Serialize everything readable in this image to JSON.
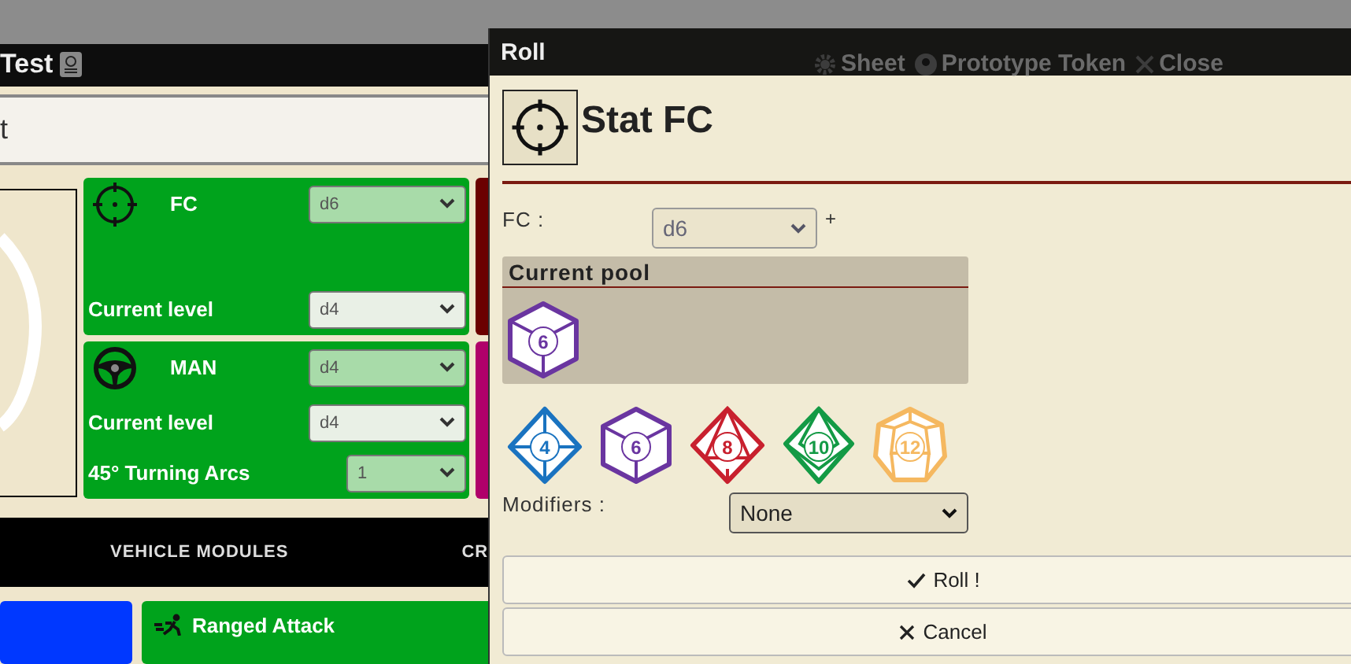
{
  "sheet": {
    "title": "Test",
    "actions": [
      {
        "label": "Sheet",
        "kind": "gear"
      },
      {
        "label": "Prototype Token",
        "kind": "user"
      },
      {
        "label": "Close",
        "kind": "close"
      }
    ],
    "name_field": {
      "value": "t"
    },
    "stats": [
      {
        "name": "FC",
        "kind": "crosshair",
        "rows": [
          {
            "value": "d6",
            "disabled": true
          },
          {
            "label": "Current level",
            "value": "d4",
            "disabled": false
          }
        ]
      },
      {
        "name": "MAN",
        "kind": "wheel",
        "rows": [
          {
            "value": "d4",
            "disabled": true
          },
          {
            "label": "Current level",
            "value": "d4",
            "disabled": false
          },
          {
            "label": "45° Turning Arcs",
            "value": "1",
            "disabled": true,
            "narrow": true
          }
        ]
      }
    ],
    "side_cards": [
      {
        "color": "#6b0000"
      },
      {
        "color": "#b0006a"
      }
    ],
    "nav": [
      {
        "label": "VEHICLE MODULES"
      },
      {
        "label": "CR"
      }
    ],
    "bottom_cards": [
      {
        "color": "#0038ff"
      },
      {
        "color": "#00a31c",
        "label": "Ranged Attack"
      }
    ]
  },
  "dialog": {
    "title": "Roll",
    "heading": "Stat FC",
    "stat": {
      "label": "FC :",
      "value": "d6",
      "plus": "+"
    },
    "pool": {
      "title": "Current pool",
      "dice": [
        {
          "kind": "d6",
          "label": "6",
          "color": "#6a35a0"
        }
      ]
    },
    "dice": [
      {
        "kind": "d4",
        "label": "4",
        "color": "#1a73c0"
      },
      {
        "kind": "d6",
        "label": "6",
        "color": "#6a35a0"
      },
      {
        "kind": "d8",
        "label": "8",
        "color": "#c8202e"
      },
      {
        "kind": "d10",
        "label": "10",
        "color": "#139a45"
      },
      {
        "kind": "d12",
        "label": "12",
        "color": "#f5b860"
      }
    ],
    "modifiers": {
      "label": "Modifiers :",
      "value": "None"
    },
    "buttons": [
      {
        "label": "Roll !",
        "kind": "check"
      },
      {
        "label": "Cancel",
        "kind": "close"
      }
    ]
  }
}
